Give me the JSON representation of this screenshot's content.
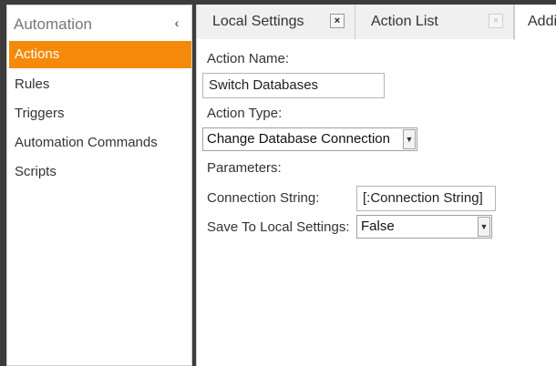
{
  "sidebar": {
    "title": "Automation",
    "collapse_glyph": "‹",
    "items": [
      {
        "label": "Actions"
      },
      {
        "label": "Rules"
      },
      {
        "label": "Triggers"
      },
      {
        "label": "Automation Commands"
      },
      {
        "label": "Scripts"
      }
    ]
  },
  "tabs": [
    {
      "label": "Local Settings",
      "close": "×"
    },
    {
      "label": "Action List",
      "close": "×"
    },
    {
      "label": "Addi"
    }
  ],
  "form": {
    "action_name_label": "Action Name:",
    "action_name_value": "Switch Databases",
    "action_type_label": "Action Type:",
    "action_type_value": "Change Database Connection",
    "parameters_label": "Parameters:",
    "connection_string_label": "Connection String:",
    "connection_string_value": "[:Connection String]",
    "save_local_label": "Save To Local Settings:",
    "save_local_value": "False"
  },
  "colors": {
    "accent": "#f58a0a"
  },
  "icons": {
    "collapse": "chevron-left-icon",
    "tab_close": "close-icon",
    "dropdown": "chevron-down-icon"
  }
}
